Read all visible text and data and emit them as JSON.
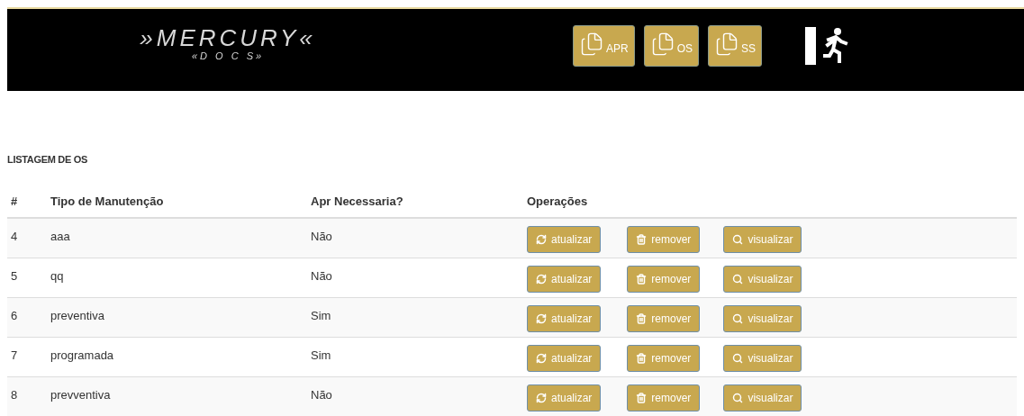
{
  "header": {
    "logo": {
      "title": "»MERCURY«",
      "subtitle": "«D O C S»"
    },
    "nav_buttons": [
      {
        "label": "APR"
      },
      {
        "label": "OS"
      },
      {
        "label": "SS"
      }
    ]
  },
  "page_title": "LISTAGEM DE OS",
  "table": {
    "columns": [
      "#",
      "Tipo de Manutenção",
      "Apr Necessaria?",
      "Operações"
    ],
    "rows": [
      {
        "id": "4",
        "tipo": "aaa",
        "apr": "Não",
        "actions": [
          "atualizar",
          "remover",
          "visualizar"
        ]
      },
      {
        "id": "5",
        "tipo": "qq",
        "apr": "Não",
        "actions": [
          "atualizar",
          "remover",
          "visualizar"
        ]
      },
      {
        "id": "6",
        "tipo": "preventiva",
        "apr": "Sim",
        "actions": [
          "atualizar",
          "remover",
          "visualizar"
        ]
      },
      {
        "id": "7",
        "tipo": "programada",
        "apr": "Sim",
        "actions": [
          "atualizar",
          "remover",
          "visualizar"
        ]
      },
      {
        "id": "8",
        "tipo": "prevventiva",
        "apr": "Não",
        "actions": [
          "atualizar",
          "remover",
          "visualizar"
        ]
      }
    ]
  }
}
